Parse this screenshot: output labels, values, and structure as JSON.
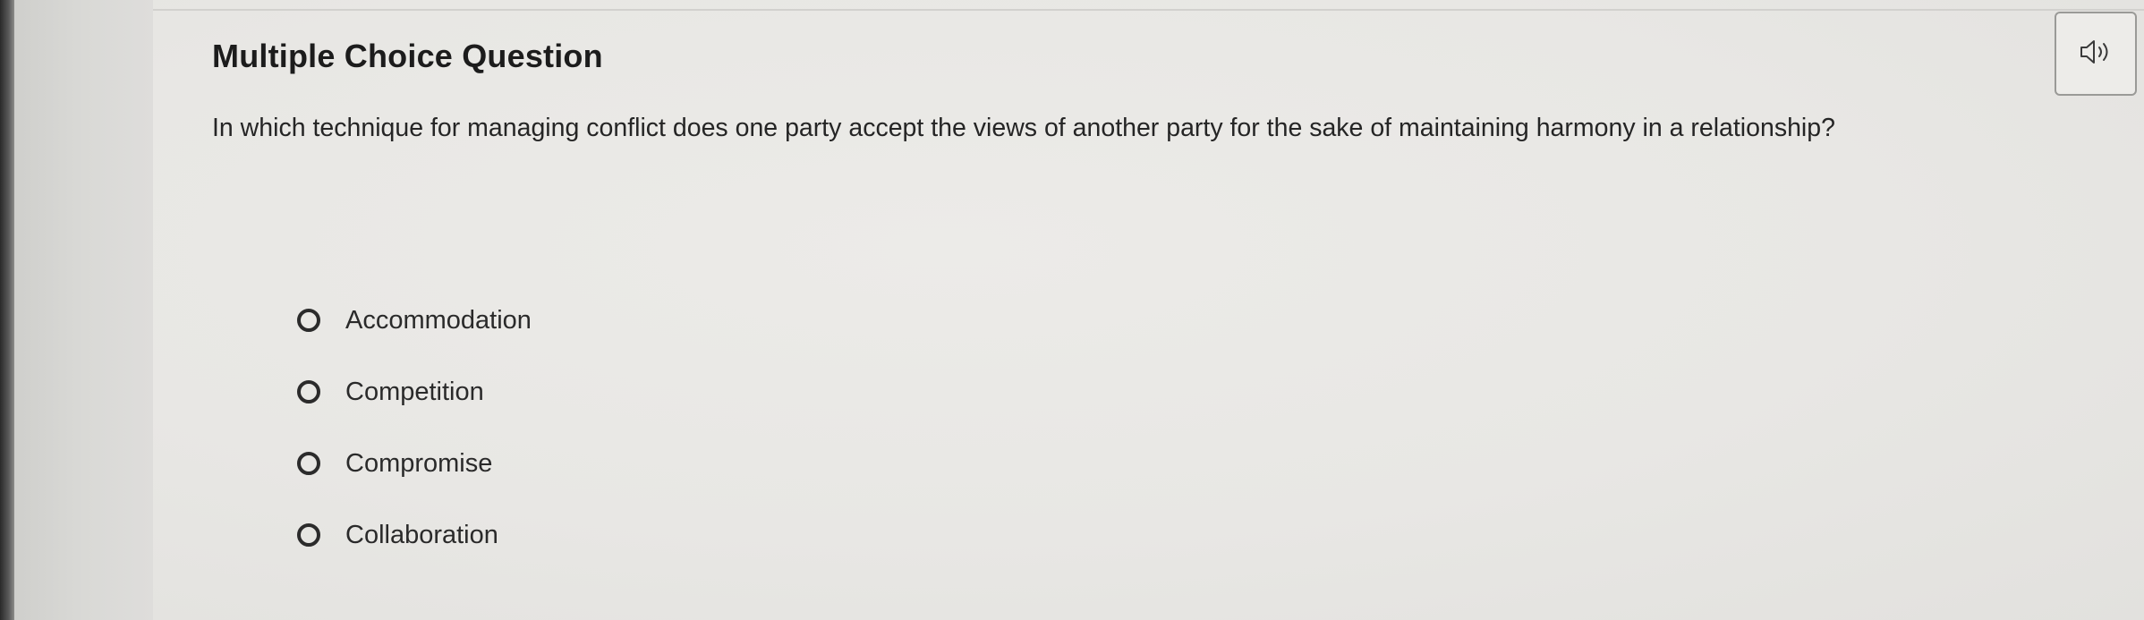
{
  "question_card": {
    "title": "Multiple Choice Question",
    "prompt": "In which technique for managing conflict does one party accept the views of another party for the sake of maintaining harmony in a relationship?",
    "audio_icon": "speaker-icon",
    "options": [
      {
        "label": "Accommodation",
        "selected": false
      },
      {
        "label": "Competition",
        "selected": false
      },
      {
        "label": "Compromise",
        "selected": false
      },
      {
        "label": "Collaboration",
        "selected": false
      }
    ]
  },
  "colors": {
    "background": "#e5e4e0",
    "text": "#1f1f1f",
    "radio_border": "#2b2b2b",
    "button_border": "#9a9a97"
  }
}
